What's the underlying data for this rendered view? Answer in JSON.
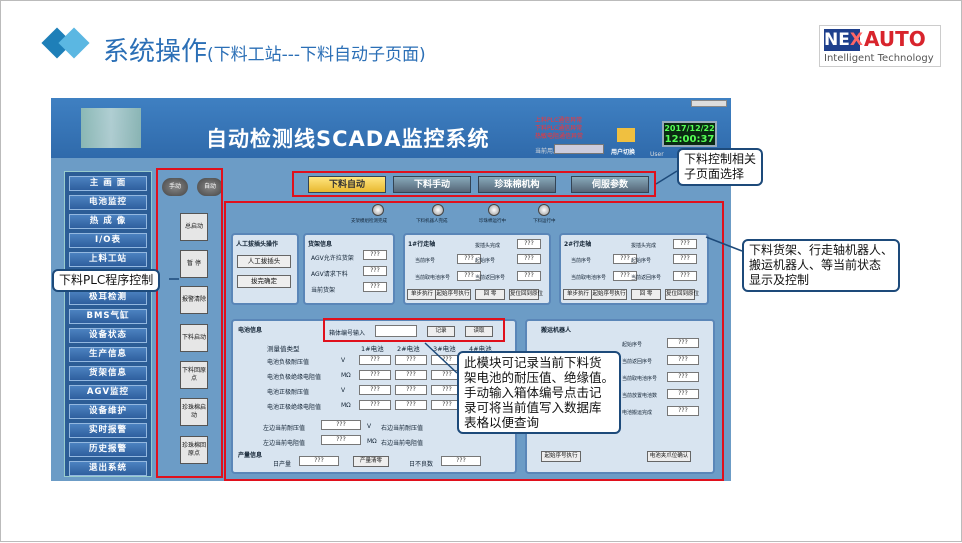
{
  "slide": {
    "title": "系统操作",
    "subtitle": "(下料工站---下料自动子页面)"
  },
  "logo": {
    "brand_a": "NE",
    "brand_x": "X",
    "brand_b": "AUTO",
    "tagline": "Intelligent Technology"
  },
  "colors": {
    "title_blue": "#2b6fb6",
    "diamond_dark": "#1e7fb8",
    "diamond_light": "#5bb7e2",
    "logo_red": "#d8242c",
    "highlight_red": "#e0101c"
  },
  "scada": {
    "title": "自动检测线SCADA监控系统",
    "alarms": [
      "上料PLC通信异常",
      "下料PLC通信异常",
      "热敏电阻通信异常"
    ],
    "current_user_label": "当前用户",
    "user_switch": "用户切换",
    "user": "User",
    "date": "2017/12/22",
    "time": "12:00:37",
    "nav": [
      "主 画 面",
      "电池监控",
      "热 成 像",
      "I/O表",
      "上料工站",
      "下料工站",
      "极耳检测",
      "BMS气缸",
      "设备状态",
      "生产信息",
      "货架信息",
      "AGV监控",
      "设备维护",
      "实时报警",
      "历史报警",
      "退出系统"
    ],
    "mode_manual": "手动",
    "mode_auto": "自动",
    "plc_buttons": [
      "总启动",
      "暂 停",
      "报警清除",
      "下料启动",
      "下料回原点",
      "珍珠棉启动",
      "珍珠棉回原点"
    ],
    "tabs": [
      "下料自动",
      "下料手动",
      "珍珠棉机构",
      "伺服参数"
    ],
    "status_lamps": [
      "支架模组检测完成",
      "下料机器人完成",
      "珍珠棉运行中",
      "下料运行中"
    ],
    "manual_pick": {
      "title": "人工拔插头操作",
      "btn1": "人工拔插头",
      "btn2": "拔完确定"
    },
    "shelf": {
      "title": "货架信息",
      "rows": [
        [
          "AGV允许拉货架",
          "???"
        ],
        [
          "AGV请求下料",
          "???"
        ],
        [
          "当前货架",
          "???"
        ]
      ]
    },
    "gantry1": {
      "title": "1#行走轴",
      "rows": [
        [
          "拔插头完成",
          "???"
        ],
        [
          "当前序号",
          "???"
        ],
        [
          "起始序号",
          "???"
        ],
        [
          "当前取电池序号",
          "???"
        ],
        [
          "当前返回序号",
          "???"
        ]
      ],
      "buttons": [
        "单步执行",
        "起始序号执行",
        "回 零",
        "复位回到原位"
      ]
    },
    "gantry2": {
      "title": "2#行走轴",
      "rows": [
        [
          "拔插头完成",
          "???"
        ],
        [
          "当前序号",
          "???"
        ],
        [
          "起始序号",
          "???"
        ],
        [
          "当前取电池序号",
          "???"
        ],
        [
          "当前返回序号",
          "???"
        ]
      ],
      "buttons": [
        "单步执行",
        "起始序号执行",
        "回 零",
        "复位回到原位"
      ]
    },
    "battery": {
      "title": "电池信息",
      "box_label": "箱体编号输入",
      "record": "记录",
      "read": "读取",
      "headers": [
        "测量值类型",
        "1#电池",
        "2#电池",
        "3#电池",
        "4#电池"
      ],
      "rows": [
        [
          "电池负极耐压值",
          "V"
        ],
        [
          "电池负极绝缘电阻值",
          "MΩ"
        ],
        [
          "电池正极耐压值",
          "V"
        ],
        [
          "电池正极绝缘电阻值",
          "MΩ"
        ]
      ],
      "val": "???",
      "left_volt": "左边当前耐压值",
      "left_res": "左边当前电阻值",
      "right_volt": "右边当前耐压值",
      "right_res": "右边当前电阻值",
      "unit_v": "V",
      "unit_m": "MΩ"
    },
    "production": {
      "title": "产量信息",
      "output": "日产量",
      "clear": "产量清零",
      "bad": "日不良数",
      "val": "???"
    },
    "robot": {
      "title": "搬运机器人",
      "rows": [
        "起始序号",
        "当前返回序号",
        "当前取电池序号",
        "当前放置电池数",
        "电池搬运完成"
      ],
      "btn1": "起始序号执行",
      "btn2": "电池夹爪位确认",
      "val": "???"
    }
  },
  "callouts": {
    "top_right": [
      "下料控制相关",
      "子页面选择"
    ],
    "right": [
      "下料货架、行走轴机器人、",
      "搬运机器人、等当前状态",
      "显示及控制"
    ],
    "left": [
      "下料PLC程序控制"
    ],
    "bottom": [
      "此模块可记录当前下料货",
      "架电池的耐压值、绝缘值。",
      "手动输入箱体编号点击记",
      "录可将当前值写入数据库",
      "表格以便查询"
    ]
  }
}
